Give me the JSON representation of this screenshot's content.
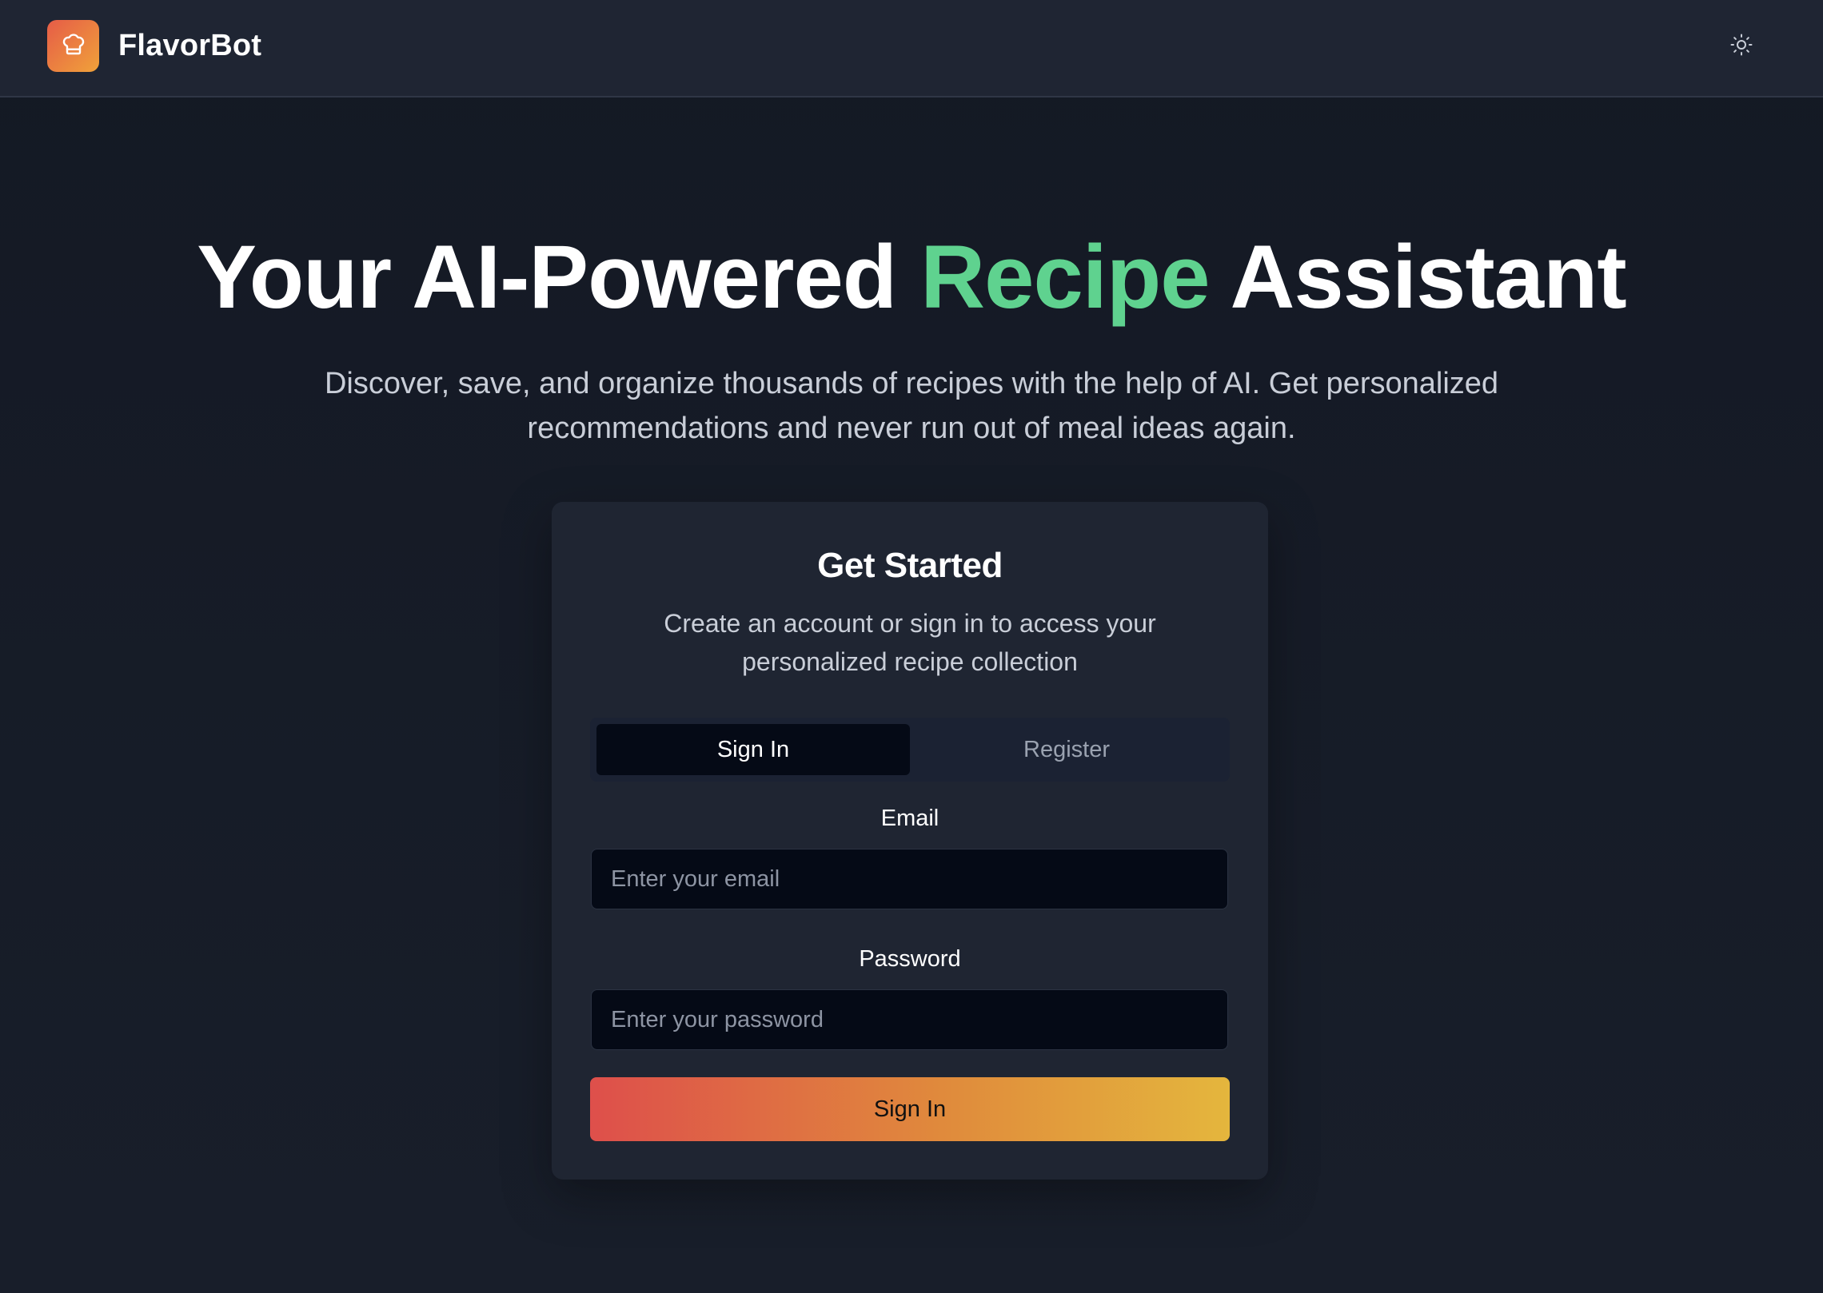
{
  "header": {
    "brand": "FlavorBot",
    "logo_icon": "chef-hat-icon",
    "theme_toggle_icon": "sun-icon"
  },
  "hero": {
    "title_part1": "Your AI-Powered ",
    "title_accent": "Recipe",
    "title_part2": " Assistant",
    "subtitle": "Discover, save, and organize thousands of recipes with the help of AI. Get personalized recommendations and never run out of meal ideas again."
  },
  "auth": {
    "title": "Get Started",
    "subtitle": "Create an account or sign in to access your personalized recipe collection",
    "tabs": [
      {
        "label": "Sign In",
        "active": true
      },
      {
        "label": "Register",
        "active": false
      }
    ],
    "email": {
      "label": "Email",
      "placeholder": "Enter your email",
      "value": ""
    },
    "password": {
      "label": "Password",
      "placeholder": "Enter your password",
      "value": ""
    },
    "submit_label": "Sign In"
  },
  "colors": {
    "accent_green": "#5fd28f",
    "gradient_start": "#de4f4b",
    "gradient_end": "#e4b63d",
    "background": "#141924",
    "card": "#1f2532"
  }
}
